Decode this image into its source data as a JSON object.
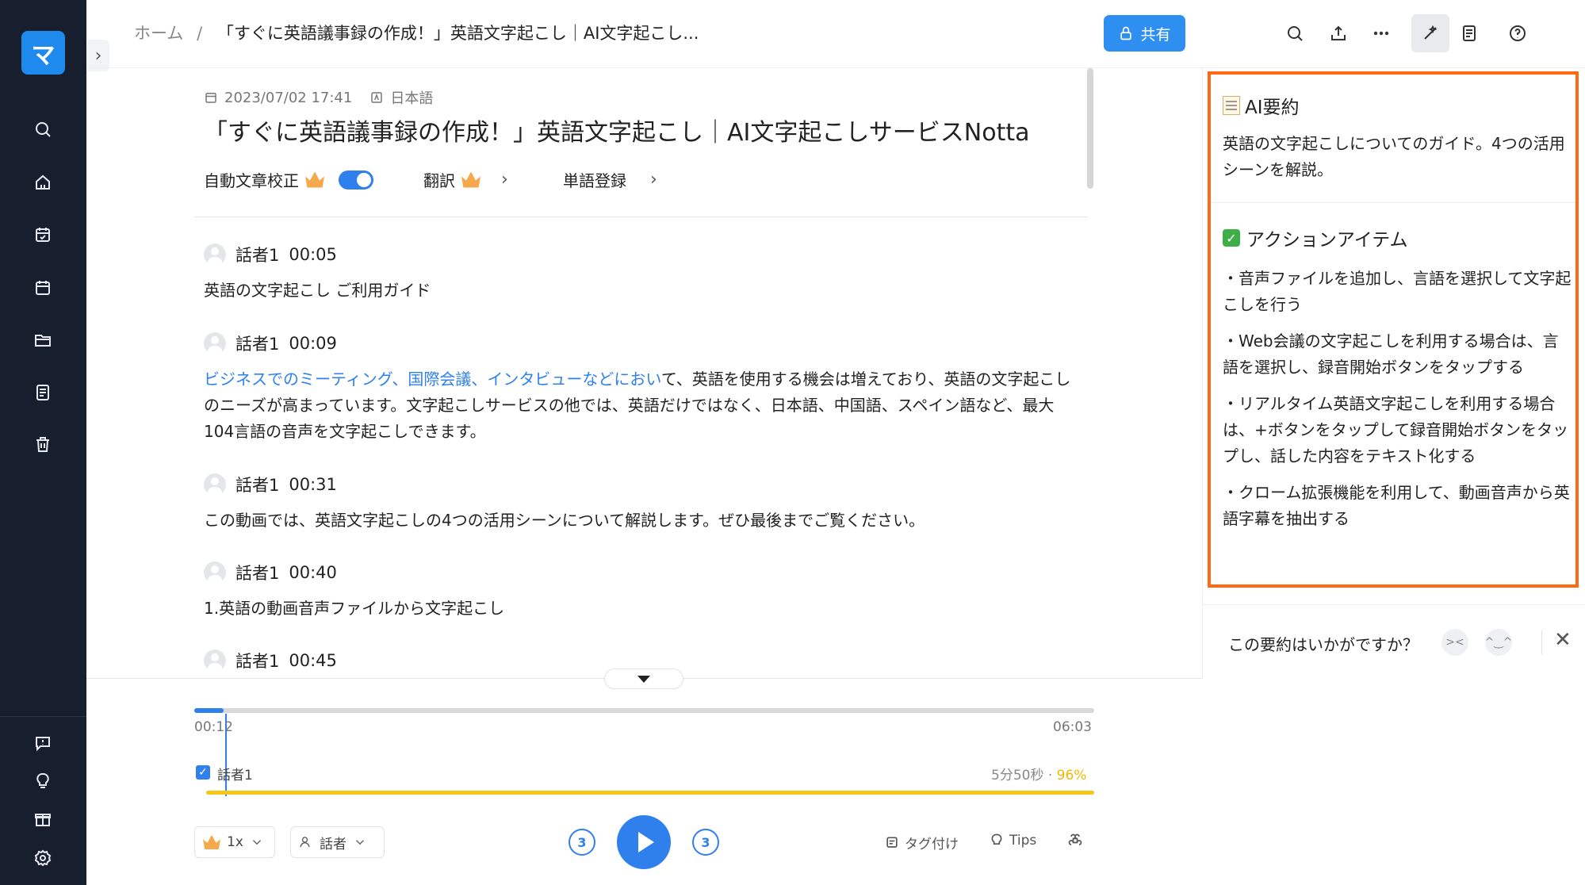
{
  "sidebar": {
    "logo": "マ",
    "icons": [
      "search-icon",
      "home-icon",
      "calendar-edit-icon",
      "calendar-icon",
      "folder-icon",
      "document-icon",
      "trash-icon",
      "feedback-icon",
      "bulb-icon",
      "gift-icon",
      "settings-icon"
    ]
  },
  "header": {
    "breadcrumb_home": "ホーム",
    "breadcrumb_sep": "/",
    "breadcrumb_current": "「すぐに英語議事録の作成！」英語文字起こし｜AI文字起こし...",
    "share_label": "共有"
  },
  "doc": {
    "date": "2023/07/02 17:41",
    "language": "日本語",
    "title": "「すぐに英語議事録の作成！」英語文字起こし｜AI文字起こしサービスNotta",
    "auto_correct": "自動文章校正",
    "auto_correct_on": true,
    "translate": "翻訳",
    "vocab": "単語登録"
  },
  "segments": [
    {
      "speaker": "話者1",
      "time": "00:05",
      "text": "英語の文字起こし ご利用ガイド"
    },
    {
      "speaker": "話者1",
      "time": "00:09",
      "link": "ビジネスでのミーティング、国際会議、インタビューなどにおい",
      "text": "て、英語を使用する機会は増えており、英語の文字起こしのニーズが高まっています。文字起こしサービスの他では、英語だけではなく、日本語、中国語、スペイン語など、最大104言語の音声を文字起こしできます。"
    },
    {
      "speaker": "話者1",
      "time": "00:31",
      "text": "この動画では、英語文字起こしの4つの活用シーンについて解説します。ぜひ最後までご覧ください。"
    },
    {
      "speaker": "話者1",
      "time": "00:40",
      "text": "1.英語の動画音声ファイルから文字起こし"
    },
    {
      "speaker": "話者1",
      "time": "00:45",
      "text": ""
    }
  ],
  "player": {
    "current": "00:12",
    "total": "06:03",
    "progress": 0.033,
    "speaker_label": "話者1",
    "speaker_duration": "5分50秒",
    "speaker_dot": "·",
    "speaker_pct": "96%",
    "speed": "1x",
    "speaker_filter": "話者",
    "skip_back": "3",
    "skip_fwd": "3",
    "tag_label": "タグ付け",
    "tips_label": "Tips"
  },
  "ai": {
    "title": "AI要約",
    "summary": "英語の文字起こしについてのガイド。4つの活用シーンを解説。",
    "actions_title": "アクションアイテム",
    "actions": [
      "・音声ファイルを追加し、言語を選択して文字起こしを行う",
      "・Web会議の文字起こしを利用する場合は、言語を選択し、録音開始ボタンをタップする",
      "・リアルタイム英語文字起こしを利用する場合は、+ボタンをタップして録音開始ボタンをタップし、話した内容をテキスト化する",
      "・クローム拡張機能を利用して、動画音声から英語字幕を抽出する"
    ],
    "feedback_q": "この要約はいかがですか？"
  },
  "colors": {
    "accent": "#2f80ed",
    "highlight_border": "#ff6a13",
    "sidebar": "#171f2f"
  }
}
